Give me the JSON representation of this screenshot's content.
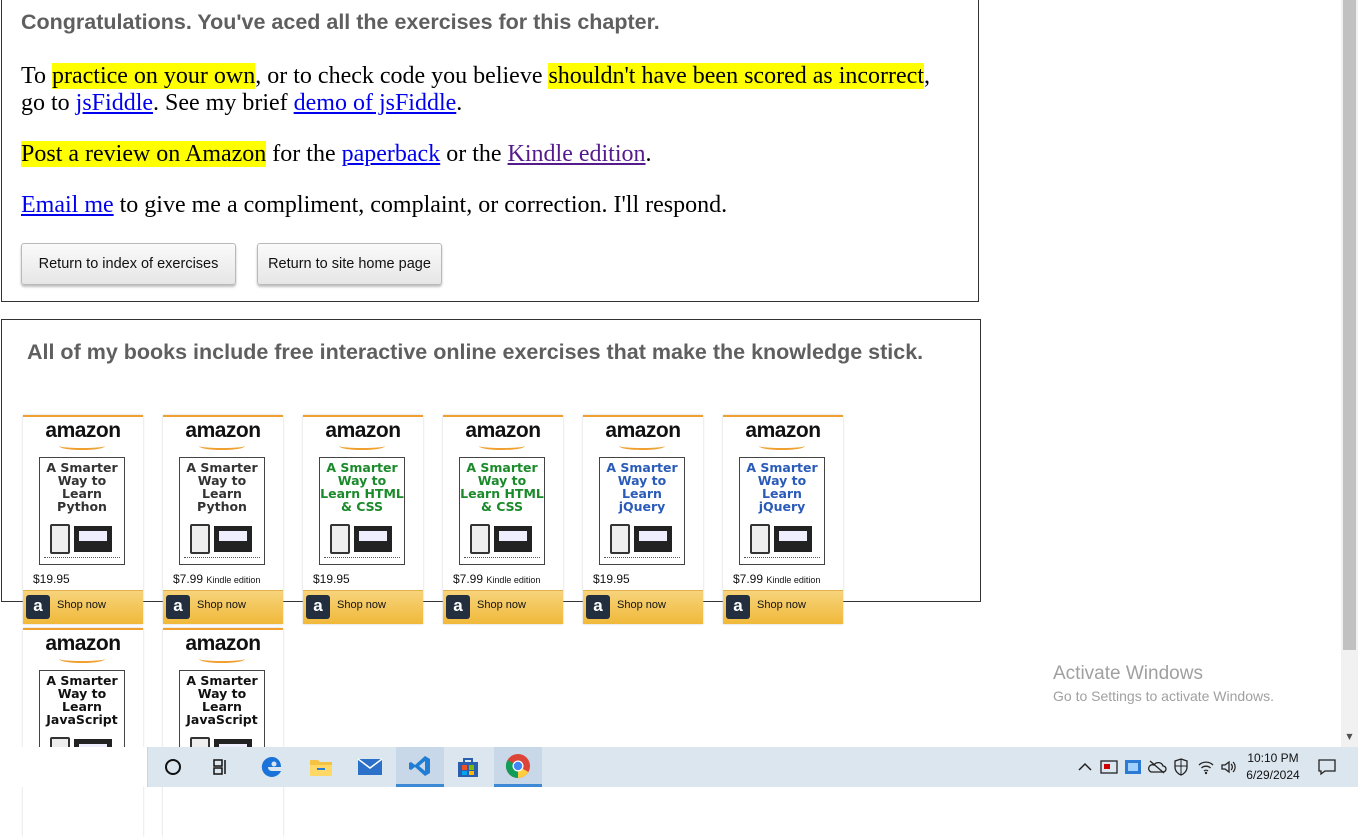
{
  "main": {
    "congrats": "Congratulations. You've aced all the exercises for this chapter.",
    "p1": {
      "t1": "To ",
      "h1": "practice on your own",
      "t2": ", or to check code you believe ",
      "h2": "shouldn't have been scored as incorrect",
      "t3": ", go to ",
      "l1": "jsFiddle",
      "t4": ". See my brief ",
      "l2": "demo of jsFiddle",
      "t5": "."
    },
    "p2": {
      "h1": "Post a review on Amazon",
      "t1": " for the ",
      "l1": "paperback",
      "t2": " or the ",
      "l2": "Kindle edition",
      "t3": "."
    },
    "p3": {
      "l1": "Email me",
      "t1": " to give me a compliment, complaint, or correction. I'll respond."
    },
    "buttons": {
      "index": "Return to index of exercises",
      "home": "Return to site home page"
    }
  },
  "books": {
    "title": "All of my books include free interactive online exercises that make the knowledge stick.",
    "items": [
      {
        "logo": "amazon",
        "cover": "A Smarter Way to Learn Python",
        "color": "#333333",
        "price": "$19.95",
        "edition": "",
        "shop": "Shop now"
      },
      {
        "logo": "amazon",
        "cover": "A Smarter Way to Learn Python",
        "color": "#333333",
        "price": "$7.99",
        "edition": "Kindle edition",
        "shop": "Shop now"
      },
      {
        "logo": "amazon",
        "cover": "A Smarter Way to Learn HTML & CSS",
        "color": "#1a8a2a",
        "price": "$19.95",
        "edition": "",
        "shop": "Shop now"
      },
      {
        "logo": "amazon",
        "cover": "A Smarter Way to Learn HTML & CSS",
        "color": "#1a8a2a",
        "price": "$7.99",
        "edition": "Kindle edition",
        "shop": "Shop now"
      },
      {
        "logo": "amazon",
        "cover": "A Smarter Way to Learn jQuery",
        "color": "#2a5bb8",
        "price": "$19.95",
        "edition": "",
        "shop": "Shop now"
      },
      {
        "logo": "amazon",
        "cover": "A Smarter Way to Learn jQuery",
        "color": "#2a5bb8",
        "price": "$7.99",
        "edition": "Kindle edition",
        "shop": "Shop now"
      },
      {
        "logo": "amazon",
        "cover": "A Smarter Way to Learn JavaScript",
        "color": "#111111",
        "price": "",
        "edition": "",
        "shop": ""
      },
      {
        "logo": "amazon",
        "cover": "A Smarter Way to Learn JavaScript",
        "color": "#111111",
        "price": "",
        "edition": "",
        "shop": ""
      }
    ]
  },
  "watermark": {
    "line1": "Activate Windows",
    "line2": "Go to Settings to activate Windows."
  },
  "taskbar": {
    "time": "10:10 PM",
    "date": "6/29/2024",
    "apps": [
      "cortana-icon",
      "task-view-icon",
      "edge-icon",
      "file-explorer-icon",
      "mail-icon",
      "vscode-icon",
      "store-icon",
      "chrome-icon"
    ]
  }
}
